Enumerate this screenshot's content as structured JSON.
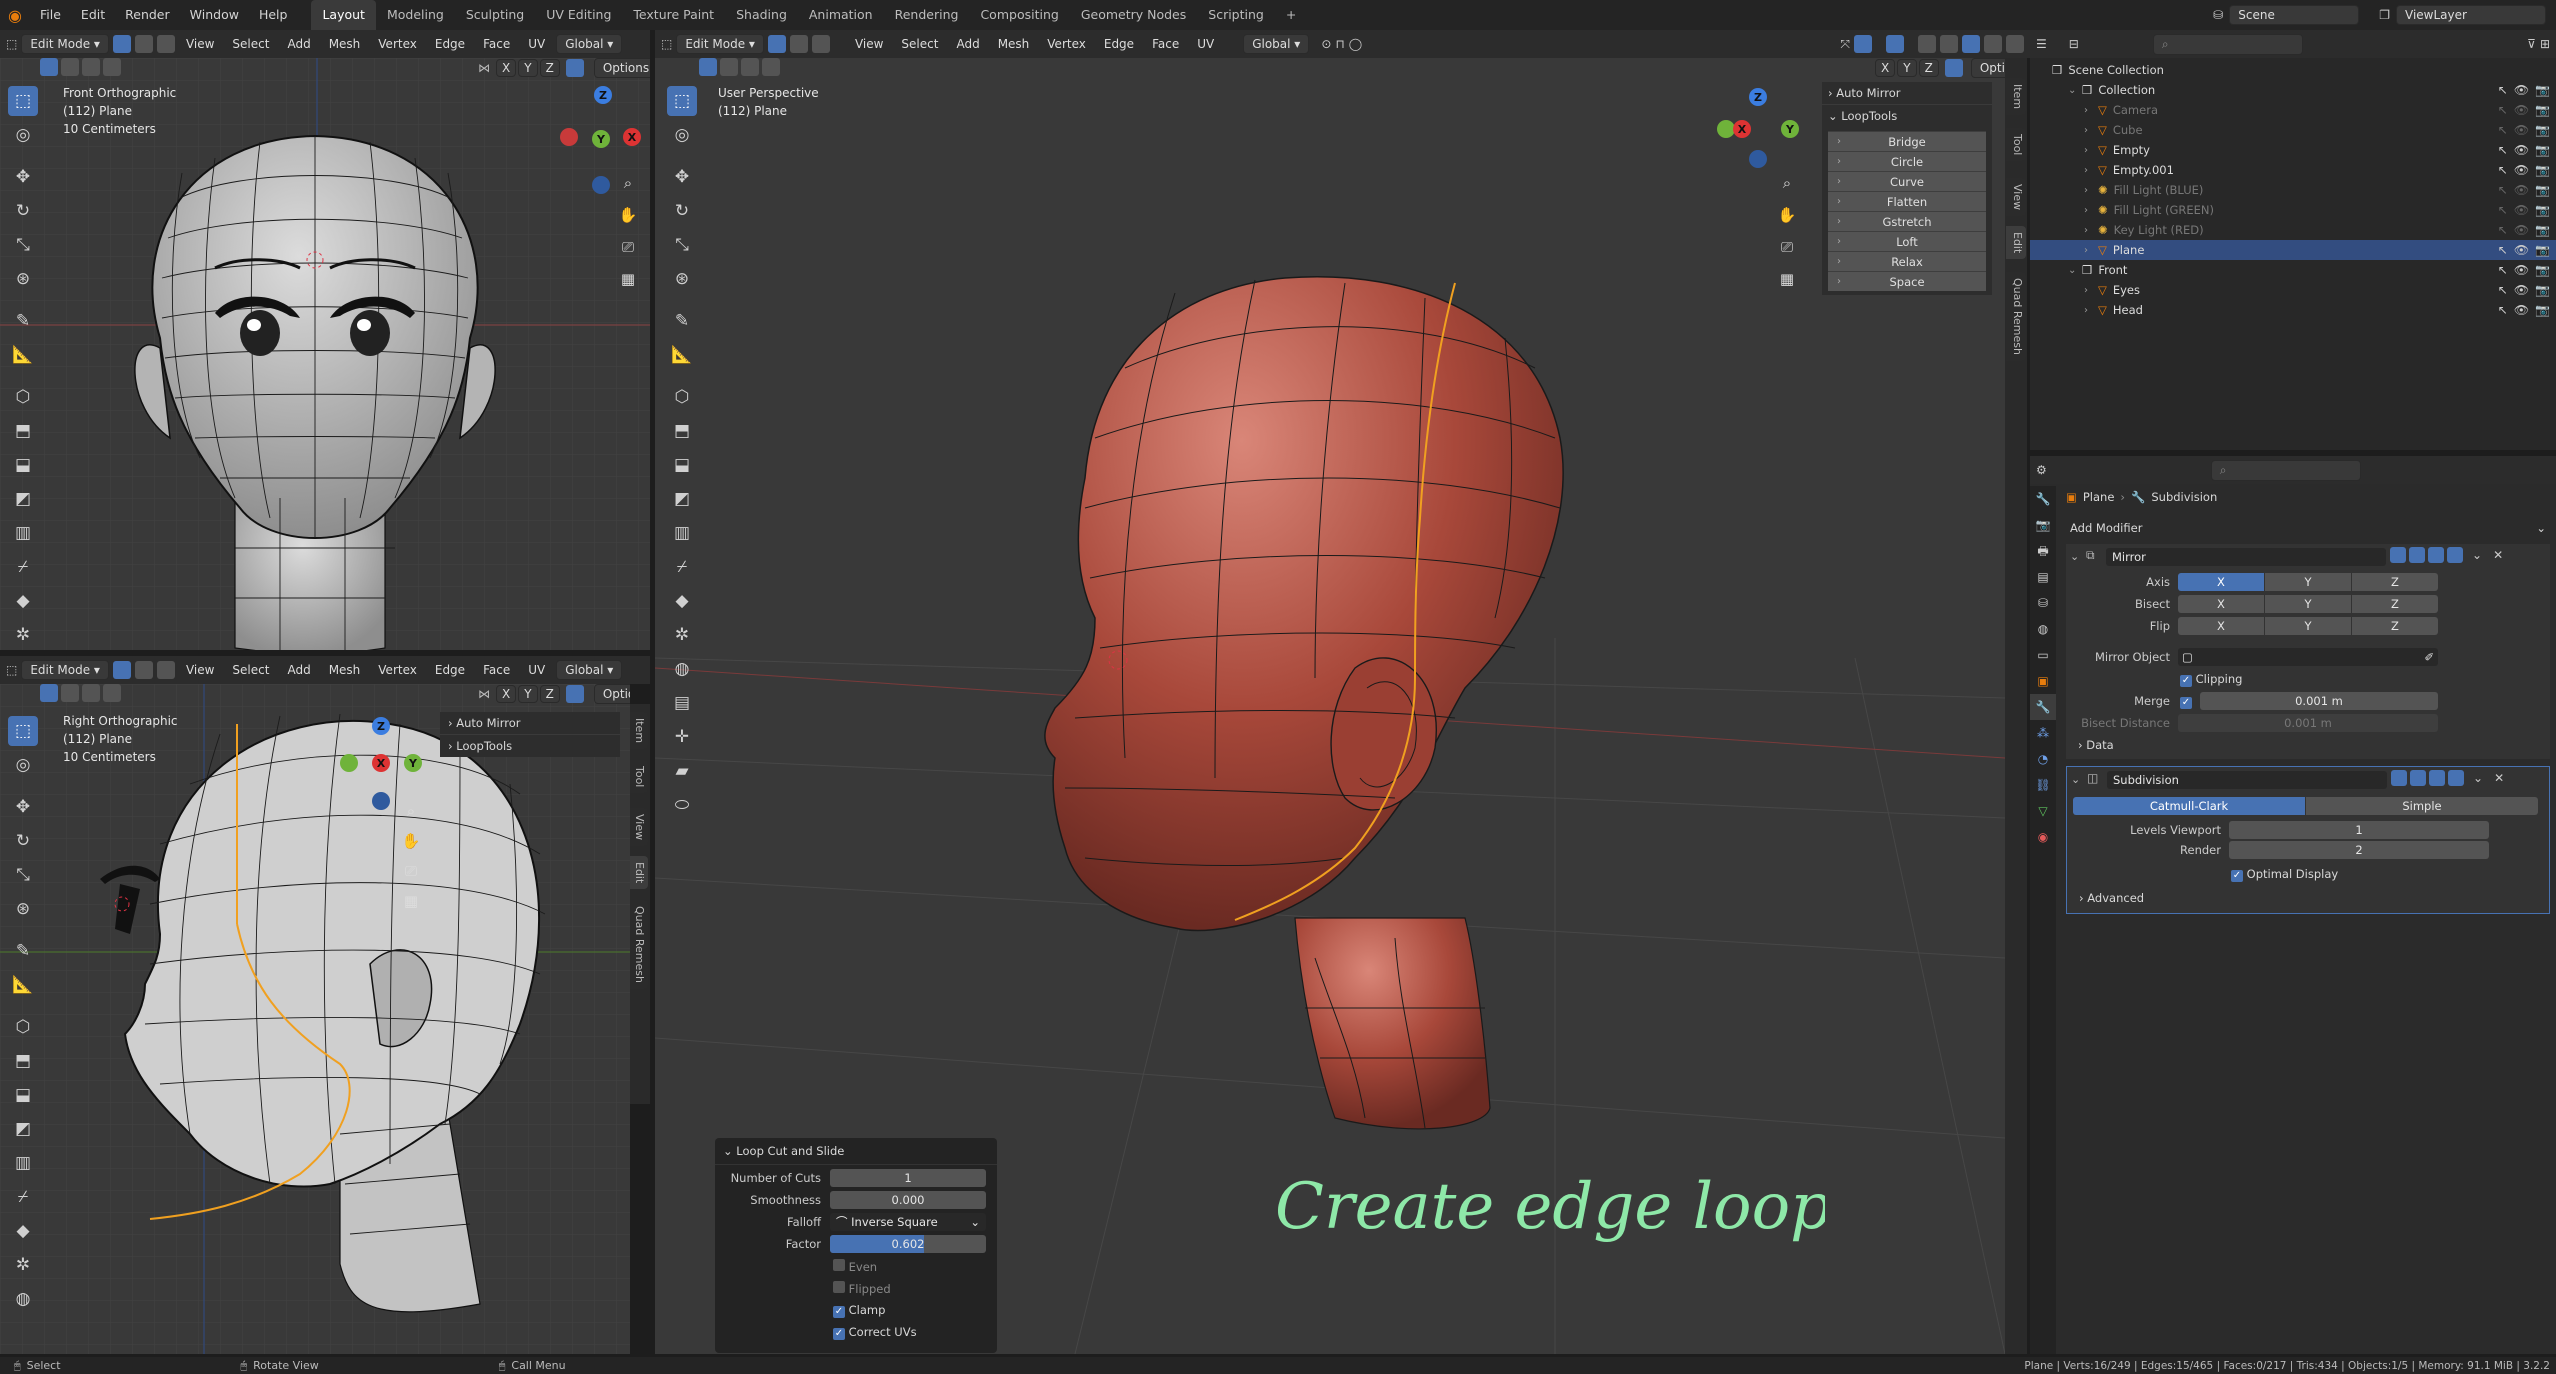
{
  "top_menu": [
    "File",
    "Edit",
    "Render",
    "Window",
    "Help"
  ],
  "workspaces": [
    "Layout",
    "Modeling",
    "Sculpting",
    "UV Editing",
    "Texture Paint",
    "Shading",
    "Animation",
    "Rendering",
    "Compositing",
    "Geometry Nodes",
    "Scripting",
    "+"
  ],
  "active_workspace": "Layout",
  "scene": "Scene",
  "view_layer": "ViewLayer",
  "viewport_header": {
    "mode": "Edit Mode",
    "menus": [
      "View",
      "Select",
      "Add",
      "Mesh",
      "Vertex",
      "Edge",
      "Face",
      "UV"
    ],
    "transform": "Global",
    "options": "Options",
    "axes": [
      "X",
      "Y",
      "Z"
    ]
  },
  "viewport_front": {
    "title": "Front Orthographic",
    "object": "(112) Plane",
    "scale": "10 Centimeters"
  },
  "viewport_right": {
    "title": "Right Orthographic",
    "object": "(112) Plane",
    "scale": "10 Centimeters",
    "panels": [
      "Auto Mirror",
      "LoopTools"
    ]
  },
  "viewport_main": {
    "title": "User Perspective",
    "object": "(112) Plane"
  },
  "side_tabs": [
    "Item",
    "Tool",
    "View",
    "Edit",
    "Quad Remesh"
  ],
  "sidebar": {
    "auto_mirror": "Auto Mirror",
    "looptools": "LoopTools",
    "looptools_buttons": [
      "Bridge",
      "Circle",
      "Curve",
      "Flatten",
      "Gstretch",
      "Loft",
      "Relax",
      "Space"
    ]
  },
  "loop_cut_panel": {
    "title": "Loop Cut and Slide",
    "number_of_cuts_label": "Number of Cuts",
    "number_of_cuts": "1",
    "smoothness_label": "Smoothness",
    "smoothness": "0.000",
    "falloff_label": "Falloff",
    "falloff": "Inverse Square",
    "factor_label": "Factor",
    "factor": "0.602",
    "factor_fraction": 0.602,
    "even": "Even",
    "flipped": "Flipped",
    "clamp": "Clamp",
    "correct_uvs": "Correct UVs"
  },
  "annotation": "Create edge loop",
  "outliner": {
    "root": "Scene Collection",
    "items": [
      {
        "name": "Collection",
        "depth": 1,
        "kind": "collection",
        "dim": false
      },
      {
        "name": "Camera",
        "depth": 2,
        "kind": "object",
        "dim": true
      },
      {
        "name": "Cube",
        "depth": 2,
        "kind": "object",
        "dim": true
      },
      {
        "name": "Empty",
        "depth": 2,
        "kind": "object",
        "dim": false
      },
      {
        "name": "Empty.001",
        "depth": 2,
        "kind": "object",
        "dim": false
      },
      {
        "name": "Fill Light (BLUE)",
        "depth": 2,
        "kind": "light",
        "dim": true
      },
      {
        "name": "Fill Light (GREEN)",
        "depth": 2,
        "kind": "light",
        "dim": true
      },
      {
        "name": "Key Light (RED)",
        "depth": 2,
        "kind": "light",
        "dim": true
      },
      {
        "name": "Plane",
        "depth": 2,
        "kind": "mesh",
        "dim": false,
        "selected": true
      },
      {
        "name": "Front",
        "depth": 1,
        "kind": "collection",
        "dim": false
      },
      {
        "name": "Eyes",
        "depth": 2,
        "kind": "object",
        "dim": false
      },
      {
        "name": "Head",
        "depth": 2,
        "kind": "object",
        "dim": false
      }
    ]
  },
  "properties": {
    "breadcrumb_object": "Plane",
    "breadcrumb_modifier": "Subdivision",
    "add_modifier": "Add Modifier",
    "mirror": {
      "name": "Mirror",
      "axis_label": "Axis",
      "bisect_label": "Bisect",
      "flip_label": "Flip",
      "axes": [
        "X",
        "Y",
        "Z"
      ],
      "mirror_object_label": "Mirror Object",
      "clipping": "Clipping",
      "merge_label": "Merge",
      "merge": "0.001 m",
      "bisect_distance_label": "Bisect Distance",
      "bisect_distance": "0.001 m",
      "data": "Data"
    },
    "subdivision": {
      "name": "Subdivision",
      "catmull": "Catmull-Clark",
      "simple": "Simple",
      "levels_viewport_label": "Levels Viewport",
      "levels_viewport": "1",
      "render_label": "Render",
      "render": "2",
      "optimal_display": "Optimal Display",
      "advanced": "Advanced"
    }
  },
  "status": {
    "left": [
      "Select",
      "Rotate View",
      "Call Menu"
    ],
    "right": "Plane | Verts:16/249 | Edges:15/465 | Faces:0/217 | Tris:434 | Objects:1/5 | Memory: 91.1 MiB | 3.2.2"
  },
  "colors": {
    "accent": "#4772b3",
    "annotation": "#8ee8a8",
    "skin": "#a8483a",
    "selected_edge": "#f0a020"
  }
}
